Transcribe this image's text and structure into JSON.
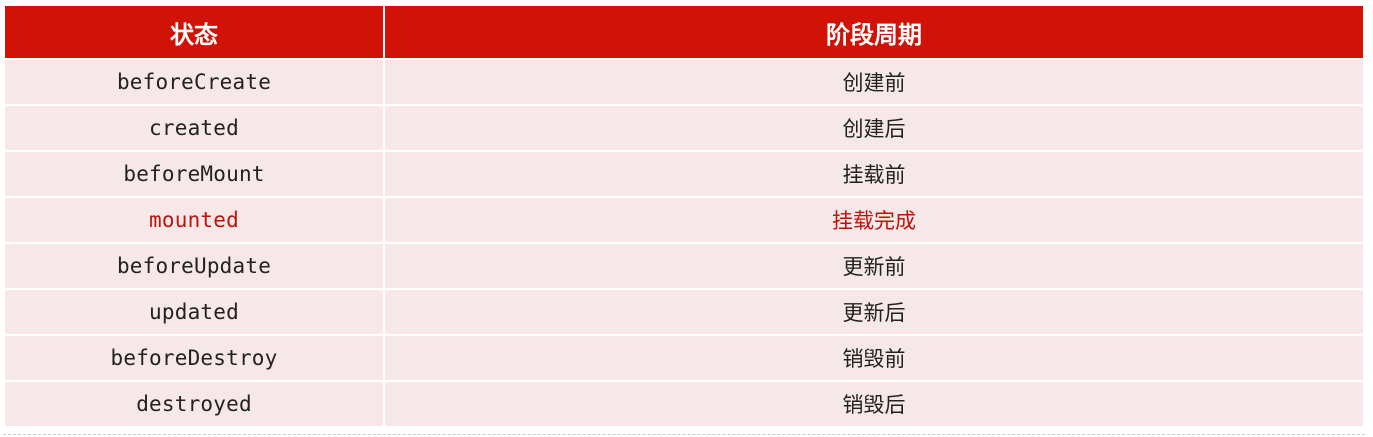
{
  "table": {
    "headers": [
      "状态",
      "阶段周期"
    ],
    "rows": [
      {
        "state": "beforeCreate",
        "phase": "创建前"
      },
      {
        "state": "created",
        "phase": "创建后"
      },
      {
        "state": "beforeMount",
        "phase": "挂载前"
      },
      {
        "state": "mounted",
        "phase": "挂载完成"
      },
      {
        "state": "beforeUpdate",
        "phase": "更新前"
      },
      {
        "state": "updated",
        "phase": "更新后"
      },
      {
        "state": "beforeDestroy",
        "phase": "销毁前"
      },
      {
        "state": "destroyed",
        "phase": "销毁后"
      }
    ],
    "highlighted_row_index": 3
  },
  "colors": {
    "header_bg": "#d11207",
    "header_text": "#ffffff",
    "row_bg": "#f6e8e8",
    "text": "#222222",
    "highlight_text": "#c0120a"
  }
}
